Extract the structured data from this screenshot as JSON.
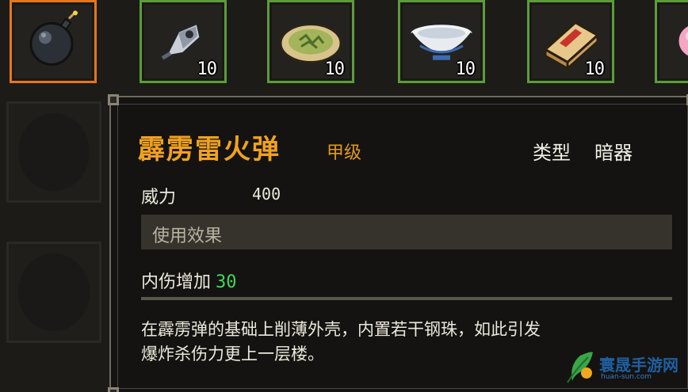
{
  "inventory": {
    "slots": [
      {
        "icon": "bomb-icon",
        "selected": true,
        "count": ""
      },
      {
        "icon": "dart-icon",
        "selected": false,
        "count": "10"
      },
      {
        "icon": "herb-cake-icon",
        "selected": false,
        "count": "10"
      },
      {
        "icon": "porcelain-bowl-icon",
        "selected": false,
        "count": "10"
      },
      {
        "icon": "manual-book-icon",
        "selected": false,
        "count": "10"
      },
      {
        "icon": "pink-pill-icon",
        "selected": false,
        "count": ""
      }
    ]
  },
  "tooltip": {
    "name": "霹雳雷火弹",
    "grade": "甲级",
    "type_label": "类型",
    "type_value": "暗器",
    "stat_label": "威力",
    "stat_value": "400",
    "effect_header": "使用效果",
    "effect_label": "内伤增加",
    "effect_value": "30",
    "description_line1": "在霹雳弹的基础上削薄外壳，内置若干钢珠，如此引发",
    "description_line2": "爆炸杀伤力更上一层楼。"
  },
  "watermark": {
    "text": "寰晟手游网",
    "url": "huan-sun.com"
  },
  "colors": {
    "selected_border": "#e3771f",
    "slot_border": "#5c9c3a",
    "item_name": "#f0a21e",
    "effect_value": "#3ed85a"
  }
}
